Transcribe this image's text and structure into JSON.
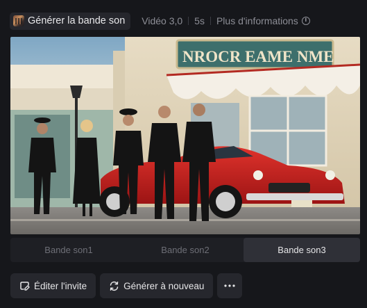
{
  "header": {
    "generate_label": "Générer la bande son",
    "generate_icon": "thumbnail-icon",
    "model_label": "Vidéo 3,0",
    "duration_label": "5s",
    "more_info_label": "Plus d'informations",
    "more_info_icon": "info-icon"
  },
  "preview": {
    "sign_text": "NROCR  EAME NME"
  },
  "tabs": [
    {
      "label": "Bande son1",
      "active": false
    },
    {
      "label": "Bande son2",
      "active": false
    },
    {
      "label": "Bande son3",
      "active": true
    }
  ],
  "actions": {
    "edit_label": "Éditer l'invite",
    "edit_icon": "edit-icon",
    "regenerate_label": "Générer à nouveau",
    "regenerate_icon": "refresh-icon",
    "more_icon": "more-icon"
  },
  "colors": {
    "background": "#16171b",
    "chip": "#25262c",
    "tab_active": "#2f3037",
    "car": "#c7201f"
  }
}
